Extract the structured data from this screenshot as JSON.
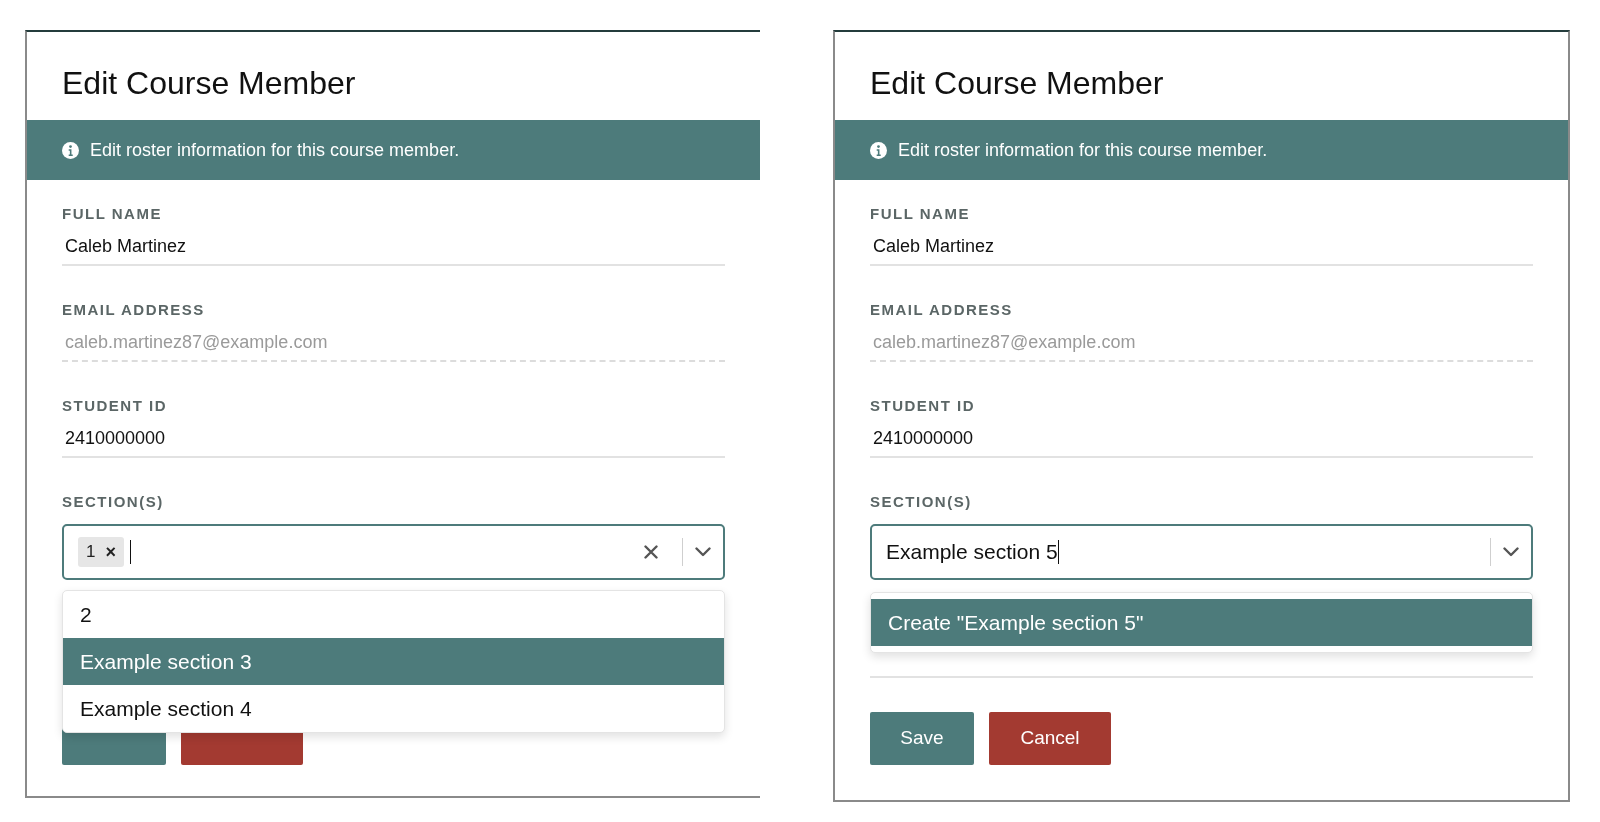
{
  "panels": [
    {
      "title": "Edit Course Member",
      "banner": "Edit roster information for this course member.",
      "right_border": false,
      "fields": [
        {
          "label": "FULL NAME",
          "value": "Caleb Martinez",
          "kind": "text"
        },
        {
          "label": "EMAIL ADDRESS",
          "value": "caleb.martinez87@example.com",
          "kind": "readonly"
        },
        {
          "label": "STUDENT ID",
          "value": "2410000000",
          "kind": "text"
        }
      ],
      "sections": {
        "label": "SECTION(S)",
        "tags": [
          {
            "label": "1",
            "remove": "×"
          }
        ],
        "focused": true,
        "clearable": true,
        "options": [
          {
            "label": "2",
            "selected": false
          },
          {
            "label": "Example section 3",
            "selected": true
          },
          {
            "label": "Example section 4",
            "selected": false
          }
        ]
      },
      "buttons": [
        {
          "kind": "primary"
        },
        {
          "kind": "danger"
        }
      ]
    },
    {
      "title": "Edit Course Member",
      "banner": "Edit roster information for this course member.",
      "right_border": true,
      "fields": [
        {
          "label": "FULL NAME",
          "value": "Caleb Martinez",
          "kind": "text"
        },
        {
          "label": "EMAIL ADDRESS",
          "value": "caleb.martinez87@example.com",
          "kind": "readonly"
        },
        {
          "label": "STUDENT ID",
          "value": "2410000000",
          "kind": "text"
        }
      ],
      "sections": {
        "label": "SECTION(S)",
        "value": "Example section 5",
        "focused": true,
        "clearable": false,
        "options": [
          {
            "label": "Create \"Example section 5\"",
            "selected": true
          }
        ]
      },
      "buttons": [
        {
          "kind": "primary",
          "label": "Save"
        },
        {
          "kind": "danger",
          "label": "Cancel"
        }
      ]
    }
  ]
}
